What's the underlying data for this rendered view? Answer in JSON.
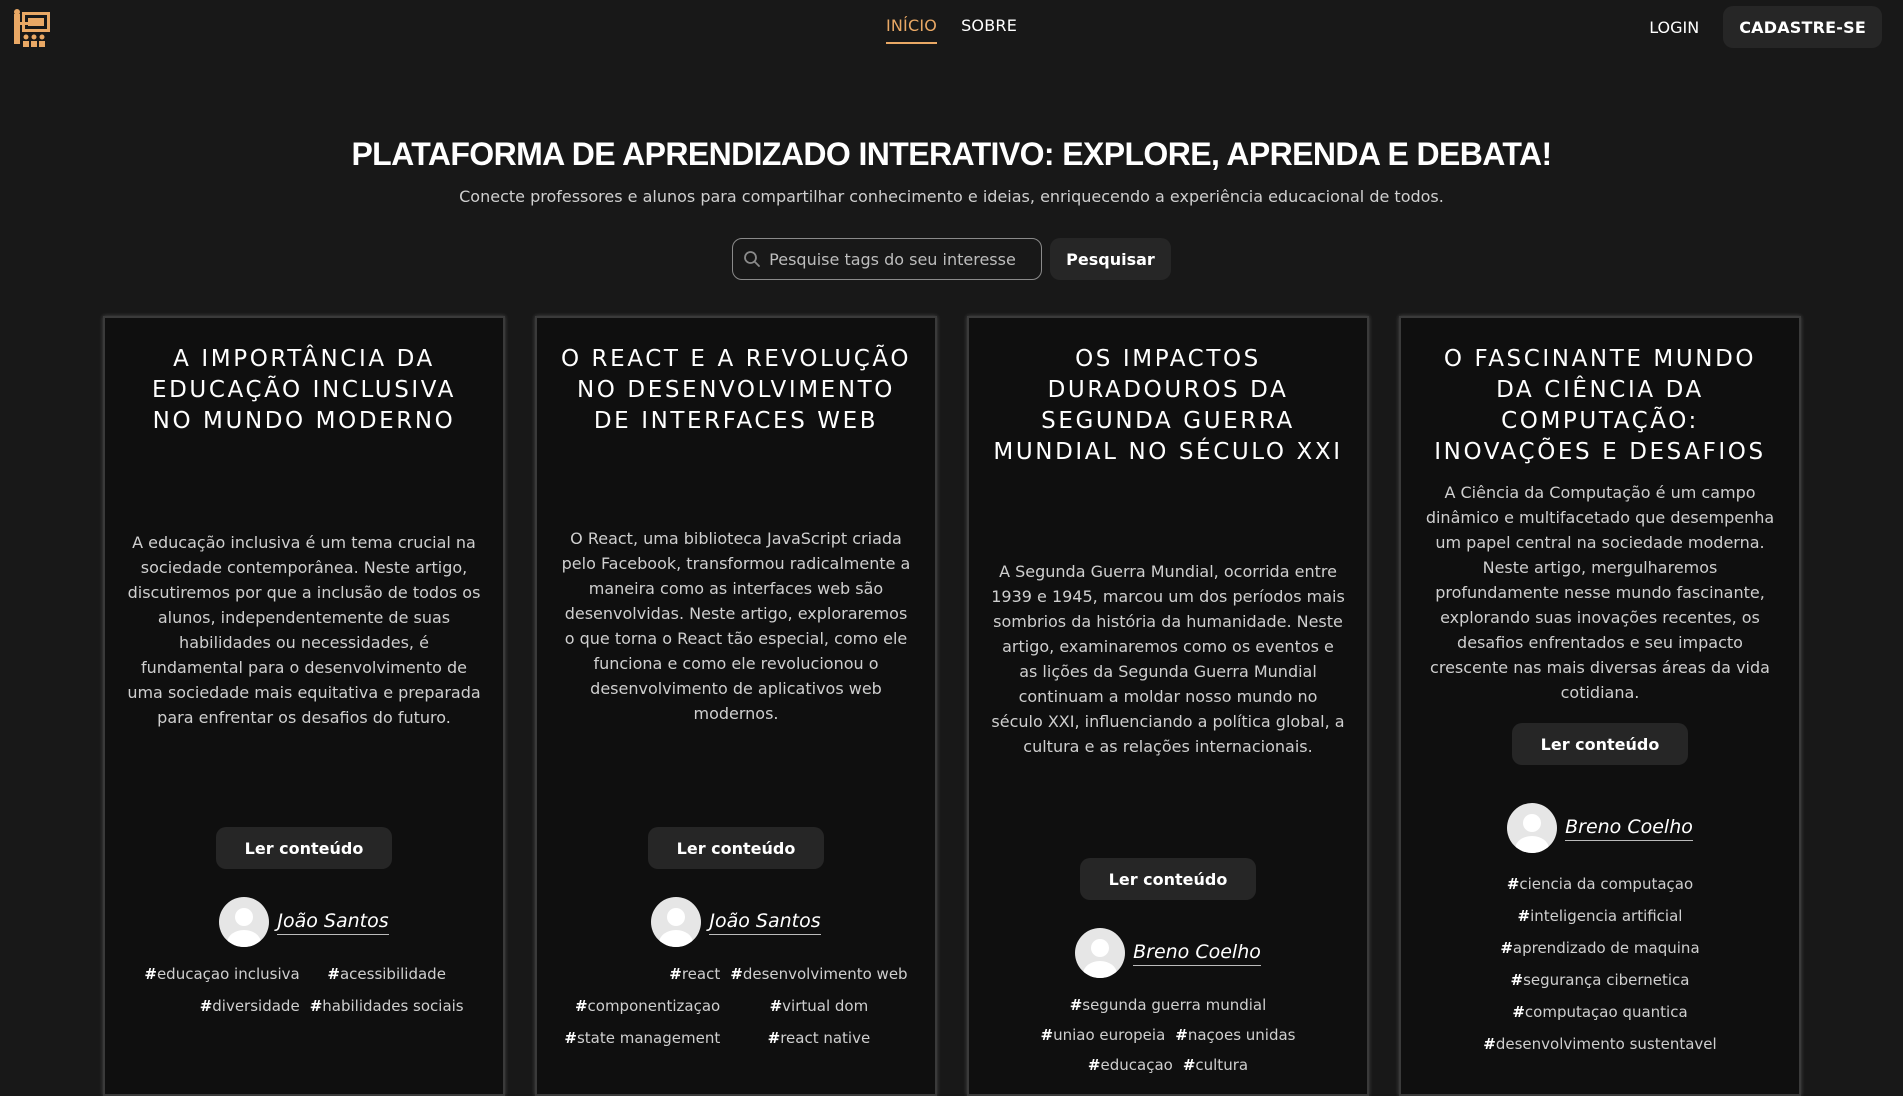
{
  "header": {
    "logo_icon": "classroom-icon",
    "nav": [
      {
        "label": "INÍCIO",
        "active": true
      },
      {
        "label": "SOBRE",
        "active": false
      }
    ],
    "login_label": "LOGIN",
    "signup_label": "CADASTRE-SE"
  },
  "hero": {
    "title": "PLATAFORMA DE APRENDIZADO INTERATIVO: EXPLORE, APRENDA E DEBATA!",
    "subtitle": "Conecte professores e alunos para compartilhar conhecimento e ideias, enriquecendo a experiência educacional de todos.",
    "search_placeholder": "Pesquise tags do seu interesse",
    "search_button": "Pesquisar"
  },
  "colors": {
    "accent": "#e9a865",
    "background": "#181818",
    "card": "#0f0f0f"
  },
  "cards": [
    {
      "title": "A IMPORTÂNCIA DA EDUCAÇÃO INCLUSIVA NO MUNDO MODERNO",
      "body": "A educação inclusiva é um tema crucial na sociedade contemporânea. Neste artigo, discutiremos por que a inclusão de todos os alunos, independentemente de suas habilidades ou necessidades, é fundamental para o desenvolvimento de uma sociedade mais equitativa e preparada para enfrentar os desafios do futuro.",
      "button": "Ler conteúdo",
      "author": "João Santos",
      "tags": [
        "educaçao inclusiva",
        "acessibilidade",
        "diversidade",
        "habilidades sociais"
      ]
    },
    {
      "title": "O REACT E A REVOLUÇÃO NO DESENVOLVIMENTO DE INTERFACES WEB",
      "body": "O React, uma biblioteca JavaScript criada pelo Facebook, transformou radicalmente a maneira como as interfaces web são desenvolvidas. Neste artigo, exploraremos o que torna o React tão especial, como ele funciona e como ele revolucionou o desenvolvimento de aplicativos web modernos.",
      "button": "Ler conteúdo",
      "author": "João Santos",
      "tags": [
        "react",
        "desenvolvimento web",
        "componentizaçao",
        "virtual dom",
        "state management",
        "react native"
      ]
    },
    {
      "title": "OS IMPACTOS DURADOUROS DA SEGUNDA GUERRA MUNDIAL NO SÉCULO XXI",
      "body": "A Segunda Guerra Mundial, ocorrida entre 1939 e 1945, marcou um dos períodos mais sombrios da história da humanidade. Neste artigo, examinaremos como os eventos e as lições da Segunda Guerra Mundial continuam a moldar nosso mundo no século XXI, influenciando a política global, a cultura e as relações internacionais.",
      "button": "Ler conteúdo",
      "author": "Breno Coelho",
      "tags": [
        "segunda guerra mundial",
        "uniao europeia",
        "naçoes unidas",
        "educaçao",
        "cultura"
      ]
    },
    {
      "title": "O FASCINANTE MUNDO DA CIÊNCIA DA COMPUTAÇÃO: INOVAÇÕES E DESAFIOS",
      "body": "A Ciência da Computação é um campo dinâmico e multifacetado que desempenha um papel central na sociedade moderna. Neste artigo, mergulharemos profundamente nesse mundo fascinante, explorando suas inovações recentes, os desafios enfrentados e seu impacto crescente nas mais diversas áreas da vida cotidiana.",
      "button": "Ler conteúdo",
      "author": "Breno Coelho",
      "tags": [
        "ciencia da computaçao",
        "inteligencia artificial",
        "aprendizado de maquina",
        "segurança cibernetica",
        "computaçao quantica",
        "desenvolvimento sustentavel"
      ]
    }
  ]
}
